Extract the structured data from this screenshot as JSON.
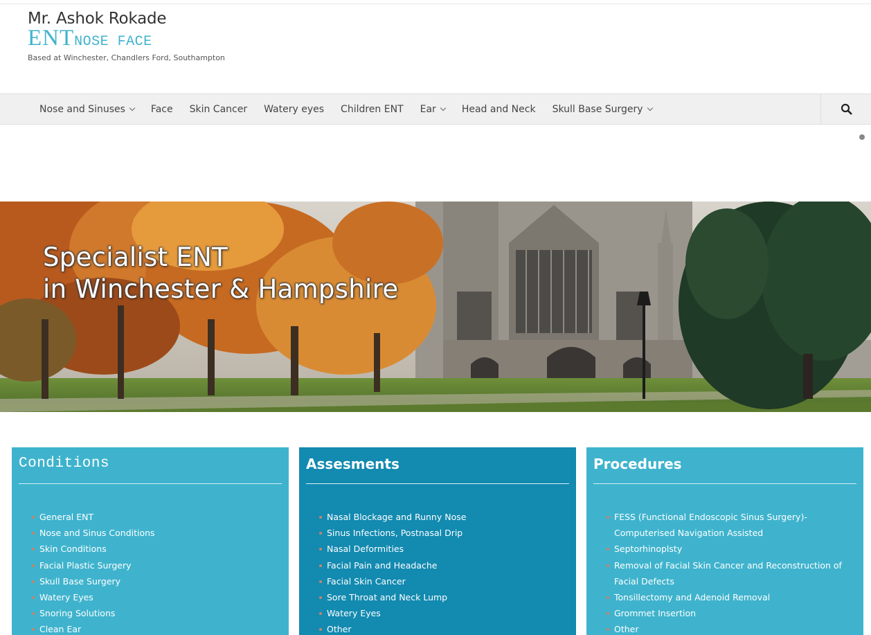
{
  "logo": {
    "name": "Mr. Ashok Rokade",
    "brand_ent": "ENT",
    "brand_noseface": "NOSE FACE",
    "tagline": "Based at Winchester, Chandlers Ford, Southampton",
    "accent_color": "#3fb3cd"
  },
  "nav": {
    "items": [
      {
        "label": "Nose and Sinuses",
        "has_dropdown": true
      },
      {
        "label": "Face",
        "has_dropdown": false
      },
      {
        "label": "Skin Cancer",
        "has_dropdown": false
      },
      {
        "label": "Watery eyes",
        "has_dropdown": false
      },
      {
        "label": "Children ENT",
        "has_dropdown": false
      },
      {
        "label": "Ear",
        "has_dropdown": true
      },
      {
        "label": "Head and Neck",
        "has_dropdown": false
      },
      {
        "label": "Skull Base Surgery",
        "has_dropdown": true
      }
    ],
    "search_icon": "search-icon"
  },
  "hero": {
    "line1": "Specialist ENT",
    "line2": "in Winchester & Hampshire"
  },
  "panels": {
    "conditions": {
      "title": "Conditions",
      "color": "#3fb3cd",
      "items": [
        "General ENT",
        "Nose and Sinus Conditions",
        "Skin Conditions",
        "Facial Plastic Surgery",
        "Skull Base Surgery",
        "Watery Eyes",
        "Snoring Solutions",
        "Clean Ear"
      ]
    },
    "assesments": {
      "title": "Assesments",
      "color": "#138ab0",
      "items": [
        "Nasal Blockage and Runny Nose",
        "Sinus Infections, Postnasal Drip",
        "Nasal Deformities",
        "Facial Pain and Headache",
        "Facial Skin Cancer",
        "Sore Throat and Neck Lump",
        "Watery Eyes",
        "Other"
      ]
    },
    "procedures": {
      "title": "Procedures",
      "color": "#3fb3cd",
      "items": [
        "FESS (Functional Endoscopic Sinus Surgery)- Computerised Navigation Assisted",
        "Septorhinoplsty",
        "Removal of Facial Skin Cancer and Reconstruction of Facial Defects",
        "Tonsillectomy and Adenoid Removal",
        "Grommet Insertion",
        "Other"
      ]
    }
  }
}
